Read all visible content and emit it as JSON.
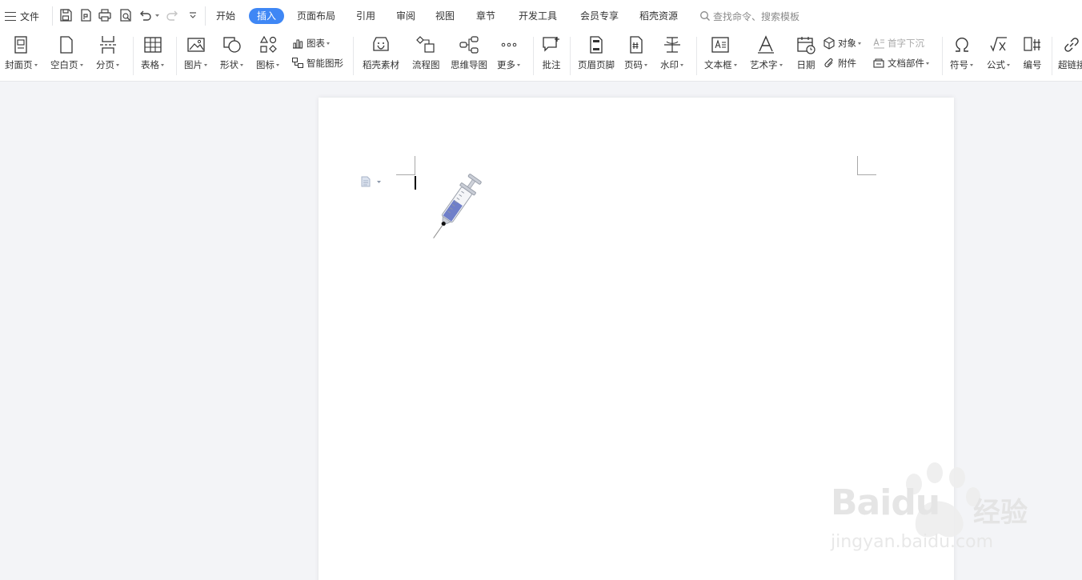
{
  "menubar": {
    "file_label": "文件",
    "tabs": [
      {
        "label": "开始"
      },
      {
        "label": "插入"
      },
      {
        "label": "页面布局"
      },
      {
        "label": "引用"
      },
      {
        "label": "审阅"
      },
      {
        "label": "视图"
      },
      {
        "label": "章节"
      },
      {
        "label": "开发工具"
      },
      {
        "label": "会员专享"
      },
      {
        "label": "稻壳资源"
      }
    ],
    "active_tab": "插入",
    "search_placeholder": "查找命令、搜索模板"
  },
  "ribbon": {
    "cover": "封面页",
    "blank": "空白页",
    "page_break": "分页",
    "table": "表格",
    "picture": "图片",
    "shape": "形状",
    "icon": "图标",
    "chart": "图表",
    "smart_art": "智能图形",
    "docer_material": "稻壳素材",
    "flowchart": "流程图",
    "mindmap": "思维导图",
    "more": "更多",
    "comment": "批注",
    "header_footer": "页眉页脚",
    "page_number": "页码",
    "watermark": "水印",
    "text_box": "文本框",
    "word_art": "艺术字",
    "date": "日期",
    "object": "对象",
    "attachment": "附件",
    "drop_cap": "首字下沉",
    "doc_parts": "文档部件",
    "symbol": "符号",
    "formula": "公式",
    "numbering": "编号",
    "hyperlink": "超链接"
  },
  "watermark_brand": {
    "line1": "Bai",
    "line1b": "du",
    "cn": "经验",
    "url": "jingyan.baidu.com"
  },
  "colors": {
    "accent": "#3f87f5",
    "canvas": "#f3f4f7",
    "syringe_fill": "#6f7fc9"
  }
}
